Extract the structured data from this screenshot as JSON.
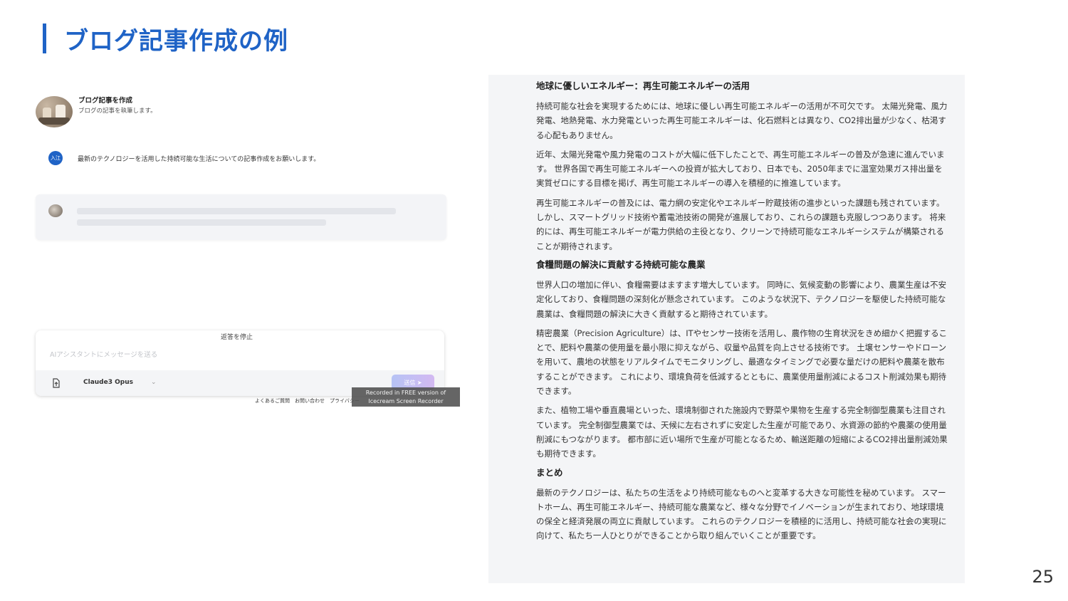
{
  "slide": {
    "title": "ブログ記事作成の例",
    "page_number": "25"
  },
  "chat": {
    "app_name": "ブログ記事を作成",
    "app_description": "ブログの記事を執筆します。",
    "user_badge": "入江",
    "user_message": "最新のテクノロジーを活用した持続可能な生活についての記事作成をお願いします。",
    "stop_label": "返答を停止",
    "input_placeholder": "AIアシスタントにメッセージを送る",
    "model_name": "Claude3 Opus",
    "send_label": "送信 ➤",
    "footer_links": "よくあるご質問　お問い合わせ　プライバシー",
    "watermark_line1": "Recorded in FREE version of",
    "watermark_line2": "Icecream Screen Recorder"
  },
  "article": {
    "blocks": [
      {
        "type": "h",
        "text": "地球に優しいエネルギー：再生可能エネルギーの活用"
      },
      {
        "type": "p",
        "text": "持続可能な社会を実現するためには、地球に優しい再生可能エネルギーの活用が不可欠です。 太陽光発電、風力発電、地熱発電、水力発電といった再生可能エネルギーは、化石燃料とは異なり、CO2排出量が少なく、枯渇する心配もありません。"
      },
      {
        "type": "p",
        "text": "近年、太陽光発電や風力発電のコストが大幅に低下したことで、再生可能エネルギーの普及が急速に進んでいます。 世界各国で再生可能エネルギーへの投資が拡大しており、日本でも、2050年までに温室効果ガス排出量を実質ゼロにする目標を掲げ、再生可能エネルギーの導入を積極的に推進しています。"
      },
      {
        "type": "p",
        "text": "再生可能エネルギーの普及には、電力網の安定化やエネルギー貯蔵技術の進歩といった課題も残されています。 しかし、スマートグリッド技術や蓄電池技術の開発が進展しており、これらの課題も克服しつつあります。 将来的には、再生可能エネルギーが電力供給の主役となり、クリーンで持続可能なエネルギーシステムが構築されることが期待されます。"
      },
      {
        "type": "h",
        "text": "食糧問題の解決に貢献する持続可能な農業"
      },
      {
        "type": "p",
        "text": "世界人口の増加に伴い、食糧需要はますます増大しています。 同時に、気候変動の影響により、農業生産は不安定化しており、食糧問題の深刻化が懸念されています。 このような状況下、テクノロジーを駆使した持続可能な農業は、食糧問題の解決に大きく貢献すると期待されています。"
      },
      {
        "type": "p",
        "text": "精密農業（Precision Agriculture）は、ITやセンサー技術を活用し、農作物の生育状況をきめ細かく把握することで、肥料や農薬の使用量を最小限に抑えながら、収量や品質を向上させる技術です。 土壌センサーやドローンを用いて、農地の状態をリアルタイムでモニタリングし、最適なタイミングで必要な量だけの肥料や農薬を散布することができます。 これにより、環境負荷を低減するとともに、農業使用量削減によるコスト削減効果も期待できます。"
      },
      {
        "type": "p",
        "text": "また、植物工場や垂直農場といった、環境制御された施設内で野菜や果物を生産する完全制御型農業も注目されています。 完全制御型農業では、天候に左右されずに安定した生産が可能であり、水資源の節約や農薬の使用量削減にもつながります。 都市部に近い場所で生産が可能となるため、輸送距離の短縮によるCO2排出量削減効果も期待できます。"
      },
      {
        "type": "h",
        "text": "まとめ"
      },
      {
        "type": "p",
        "text": "最新のテクノロジーは、私たちの生活をより持続可能なものへと変革する大きな可能性を秘めています。 スマートホーム、再生可能エネルギー、持続可能な農業など、様々な分野でイノベーションが生まれており、地球環境の保全と経済発展の両立に貢献しています。 これらのテクノロジーを積極的に活用し、持続可能な社会の実現に向けて、私たち一人ひとりができることから取り組んでいくことが重要です。"
      }
    ]
  }
}
